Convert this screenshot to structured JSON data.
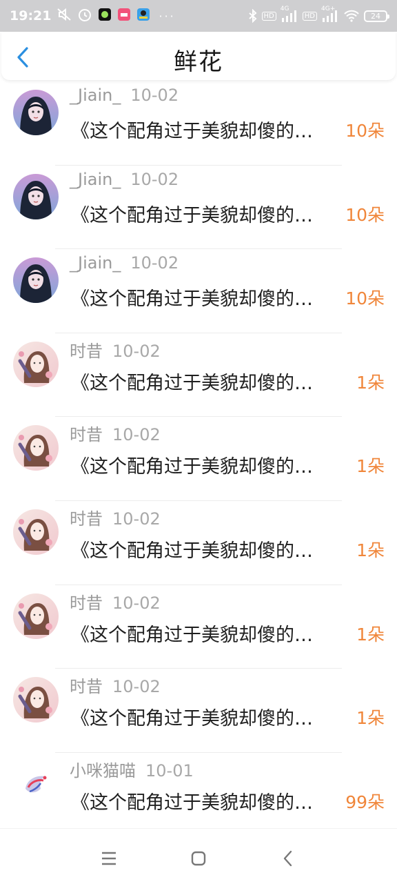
{
  "status_bar": {
    "time": "19:21",
    "battery": "24",
    "network_1": "4G",
    "network_2": "4G+",
    "hd_1": "HD",
    "hd_2": "HD"
  },
  "header": {
    "title": "鲜花",
    "back_icon": "chevron-left-icon"
  },
  "colors": {
    "accent_blue": "#2b8fe0",
    "amount_orange": "#f0863a",
    "muted_text": "#9a9a9a"
  },
  "items": [
    {
      "name": "_Jiain_",
      "date": "10-02",
      "text": "《这个配角过于美貌却傻的…",
      "amount": "10朵",
      "avatar": "dark-hair-girl"
    },
    {
      "name": "_Jiain_",
      "date": "10-02",
      "text": "《这个配角过于美貌却傻的…",
      "amount": "10朵",
      "avatar": "dark-hair-girl"
    },
    {
      "name": "_Jiain_",
      "date": "10-02",
      "text": "《这个配角过于美貌却傻的…",
      "amount": "10朵",
      "avatar": "dark-hair-girl"
    },
    {
      "name": "时昔",
      "date": "10-02",
      "text": "《这个配角过于美貌却傻的…",
      "amount": "1朵",
      "avatar": "flower-girl"
    },
    {
      "name": "时昔",
      "date": "10-02",
      "text": "《这个配角过于美貌却傻的…",
      "amount": "1朵",
      "avatar": "flower-girl"
    },
    {
      "name": "时昔",
      "date": "10-02",
      "text": "《这个配角过于美貌却傻的…",
      "amount": "1朵",
      "avatar": "flower-girl"
    },
    {
      "name": "时昔",
      "date": "10-02",
      "text": "《这个配角过于美貌却傻的…",
      "amount": "1朵",
      "avatar": "flower-girl"
    },
    {
      "name": "时昔",
      "date": "10-02",
      "text": "《这个配角过于美貌却傻的…",
      "amount": "1朵",
      "avatar": "flower-girl"
    },
    {
      "name": "小咪猫喵",
      "date": "10-01",
      "text": "《这个配角过于美貌却傻的…",
      "amount": "99朵",
      "avatar": "abstract-bird"
    }
  ],
  "nav": {
    "menu_icon": "menu-icon",
    "home_icon": "home-square-icon",
    "back_icon": "back-arrow-icon"
  }
}
